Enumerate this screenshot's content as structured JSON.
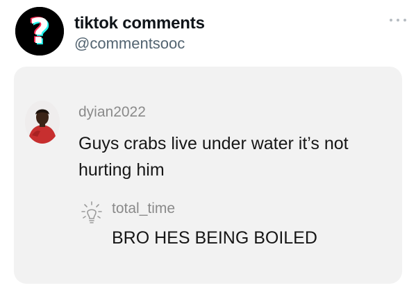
{
  "post": {
    "account_name": "tiktok comments",
    "account_handle": "@commentsooc",
    "avatar_icon": "question-mark-icon",
    "more_icon": "more-options-icon"
  },
  "comment": {
    "username": "dyian2022",
    "text": "Guys crabs live under water it’s not hurting him"
  },
  "reply": {
    "icon": "lightbulb-icon",
    "username": "total_time",
    "text": "BRO HES BEING BOILED"
  },
  "colors": {
    "card_background": "#f2f2f2",
    "tiktok_cyan": "#25f4ee",
    "tiktok_red": "#fe2c55"
  }
}
